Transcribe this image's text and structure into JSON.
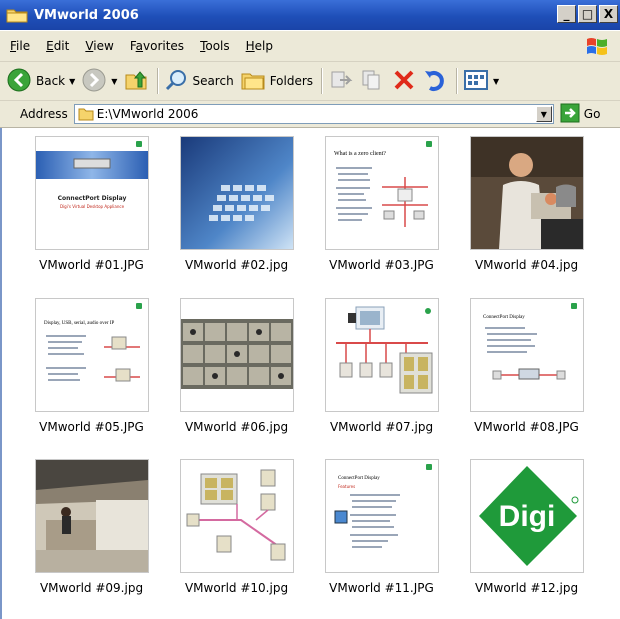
{
  "window": {
    "title": "VMworld 2006"
  },
  "title_buttons": {
    "minimize": "_",
    "maximize": "□",
    "close": "X"
  },
  "menu": {
    "items": [
      {
        "pre": "",
        "u": "F",
        "post": "ile"
      },
      {
        "pre": "",
        "u": "E",
        "post": "dit"
      },
      {
        "pre": "",
        "u": "V",
        "post": "iew"
      },
      {
        "pre": "F",
        "u": "a",
        "post": "vorites"
      },
      {
        "pre": "",
        "u": "T",
        "post": "ools"
      },
      {
        "pre": "",
        "u": "H",
        "post": "elp"
      }
    ]
  },
  "toolbar": {
    "back_label": "Back",
    "search_label": "Search",
    "folders_label": "Folders"
  },
  "address": {
    "label": "Address",
    "value": "E:\\VMworld 2006",
    "go_label": "Go"
  },
  "files": [
    {
      "name": "VMworld #01.JPG"
    },
    {
      "name": "VMworld #02.jpg"
    },
    {
      "name": "VMworld #03.JPG"
    },
    {
      "name": "VMworld #04.jpg"
    },
    {
      "name": "VMworld #05.JPG"
    },
    {
      "name": "VMworld #06.jpg"
    },
    {
      "name": "VMworld #07.jpg"
    },
    {
      "name": "VMworld #08.JPG"
    },
    {
      "name": "VMworld #09.jpg"
    },
    {
      "name": "VMworld #10.jpg"
    },
    {
      "name": "VMworld #11.JPG"
    },
    {
      "name": "VMworld #12.jpg"
    }
  ],
  "thumbnail_text": {
    "t01_title": "ConnectPort Display",
    "t01_sub": "Digi's Virtual Desktop Appliance",
    "t03_title": "What is a zero client?",
    "t05_title": "Display, USB, serial, audio over IP",
    "t08_title": "ConnectPort Display",
    "t11_title": "ConnectPort Display",
    "t11_sub": "Features",
    "t12_logo": "Digi"
  },
  "colors": {
    "titlebar": "#1f4fb8",
    "chrome": "#ece9d8",
    "digi_green": "#1f9a3a"
  }
}
